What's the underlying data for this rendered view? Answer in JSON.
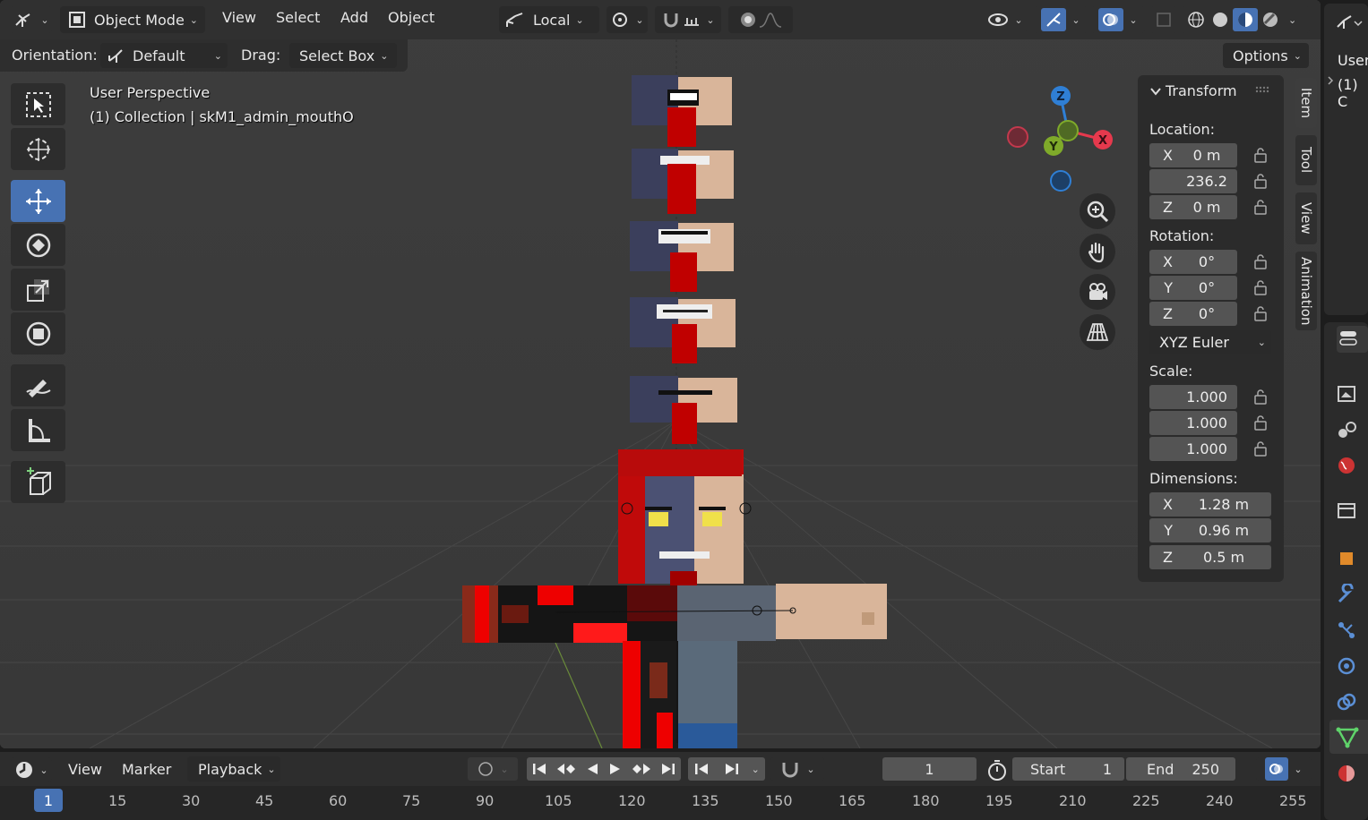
{
  "header": {
    "editor_type_icon": "3d-viewport-icon",
    "mode_label": "Object Mode",
    "menus": [
      "View",
      "Select",
      "Add",
      "Object"
    ],
    "transform_orientation": "Local",
    "options_label": "Options"
  },
  "tool_settings": {
    "orientation_label": "Orientation:",
    "orientation_value": "Default",
    "drag_label": "Drag:",
    "drag_value": "Select Box"
  },
  "viewport_overlay": {
    "view_name": "User Perspective",
    "collection_info": "(1) Collection | skM1_admin_mouthO"
  },
  "gizmo": {
    "axes": [
      "Z",
      "X",
      "Y"
    ]
  },
  "toolbar": {
    "tools": [
      "select-box-icon",
      "cursor-icon",
      "move-icon",
      "rotate-icon",
      "scale-icon",
      "transform-icon",
      "annotate-icon",
      "measure-icon",
      "add-cube-icon"
    ],
    "active": "move-icon"
  },
  "npanel": {
    "section_title": "Transform",
    "location_label": "Location:",
    "location": [
      {
        "axis": "X",
        "value": "0 m"
      },
      {
        "axis": "",
        "value": "236.2"
      },
      {
        "axis": "Z",
        "value": "0 m"
      }
    ],
    "rotation_label": "Rotation:",
    "rotation": [
      {
        "axis": "X",
        "value": "0°"
      },
      {
        "axis": "Y",
        "value": "0°"
      },
      {
        "axis": "Z",
        "value": "0°"
      }
    ],
    "rotation_mode": "XYZ Euler",
    "scale_label": "Scale:",
    "scale": [
      {
        "axis": "",
        "value": "1.000"
      },
      {
        "axis": "",
        "value": "1.000"
      },
      {
        "axis": "",
        "value": "1.000"
      }
    ],
    "dimensions_label": "Dimensions:",
    "dimensions": [
      {
        "axis": "X",
        "value": "1.28 m"
      },
      {
        "axis": "Y",
        "value": "0.96 m"
      },
      {
        "axis": "Z",
        "value": "0.5 m"
      }
    ],
    "tabs": [
      "Item",
      "Tool",
      "View",
      "Animation"
    ]
  },
  "right_area": {
    "header_text_1": "User",
    "header_text_2": "(1) C"
  },
  "timeline": {
    "menus": [
      "View",
      "Marker",
      "Playback"
    ],
    "current_frame": "1",
    "start_label": "Start",
    "start_value": "1",
    "end_label": "End",
    "end_value": "250",
    "ruler": [
      "1",
      "15",
      "30",
      "45",
      "60",
      "75",
      "90",
      "105",
      "120",
      "135",
      "150",
      "165",
      "180",
      "195",
      "210",
      "225",
      "240",
      "255"
    ]
  },
  "colors": {
    "accent": "#4772b3",
    "axis_x": "#e6394d",
    "axis_y": "#7faa2a",
    "axis_z": "#2f7fd5"
  }
}
